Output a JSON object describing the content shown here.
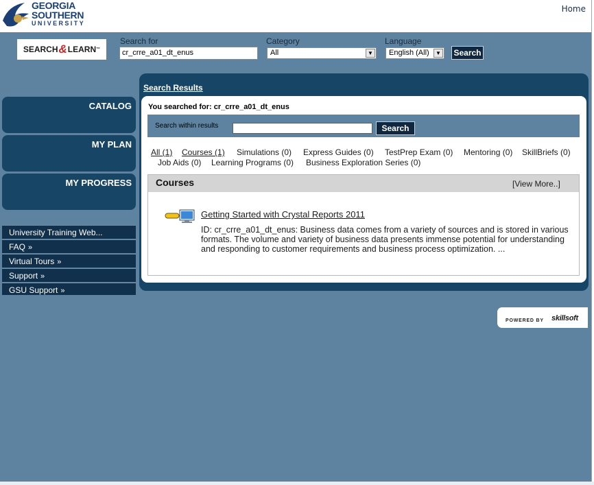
{
  "header": {
    "logo_lines": [
      "GEORGIA",
      "SOUTHERN",
      "UNIVERSITY"
    ],
    "home_label": "Home"
  },
  "search": {
    "logo_left": "SEARCH",
    "logo_amp": "&",
    "logo_right": "LEARN",
    "logo_tm": "™",
    "search_for_label": "Search for",
    "search_value": "cr_crre_a01_dt_enus",
    "category_label": "Category",
    "category_value": "All",
    "language_label": "Language",
    "language_value": "English (All)",
    "search_button": "Search"
  },
  "nav": {
    "boxes": [
      "CATALOG",
      "MY PLAN",
      "MY PROGRESS"
    ],
    "links": [
      "University Training Web...",
      "FAQ",
      "Virtual Tours",
      "Support",
      "GSU Support"
    ],
    "chevron": "»"
  },
  "results": {
    "title": "Search Results",
    "you_searched": "You searched for: cr_crre_a01_dt_enus",
    "within_label": "Search within results",
    "within_value": "",
    "within_button": "Search",
    "tabs_row1": [
      "All (1)",
      "Courses (1)",
      "Simulations (0)",
      "Express Guides (0)",
      "TestPrep Exam (0)",
      "Mentoring (0)",
      "SkillBriefs (0)"
    ],
    "tabs_row2": [
      "Job Aids (0)",
      "Learning Programs (0)",
      "Business Exploration Series (0)"
    ],
    "courses_heading": "Courses",
    "view_more": "[View More..]",
    "course_title": "Getting Started with Crystal Reports 2011",
    "course_description": "ID: cr_crre_a01_dt_enus: Business data comes from a variety of sources and is stored in various formats. The volume and variety of business data presents immense potential for understanding and responding to customer requirements and business process optimization. ..."
  },
  "footer": {
    "powered_by": "POWERED BY",
    "brand": "skillsoft"
  },
  "colors": {
    "page_bg": "#5d83a0",
    "panel": "#164565",
    "nav_link": "#10304b",
    "button": "#10283f"
  }
}
